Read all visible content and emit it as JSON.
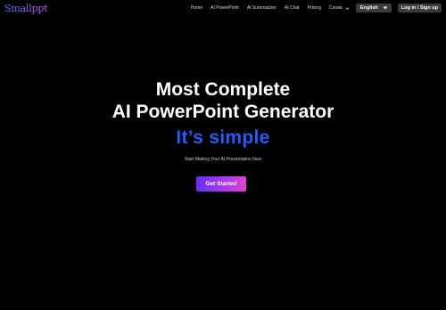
{
  "brand": {
    "logo_text": "Smallppt",
    "logo_colors": [
      "#5b6cff",
      "#a15cff",
      "#d35cff"
    ]
  },
  "nav": {
    "links": [
      "Home",
      "AI PowerPoint",
      "AI Summarizer",
      "AI Chat",
      "Pricing"
    ],
    "create_label": "Create",
    "create_icon": "chevron-down-icon",
    "language_label": "English",
    "language_icon": "caret-down-icon",
    "login_label": "Log in / Sign up"
  },
  "hero": {
    "title_line1": "Most Complete",
    "title_line2": "AI PowerPoint Generator",
    "tagline": "It’s simple",
    "tagline_color": "#1f5eff",
    "subtext": "Start Making Your AI Presentation Now",
    "cta_label": "Get Started",
    "cta_gradient": [
      "#6a2cf5",
      "#a03aee",
      "#e440d8"
    ]
  },
  "theme": {
    "background": "#000000",
    "button_bg": "#3b3b3b"
  }
}
